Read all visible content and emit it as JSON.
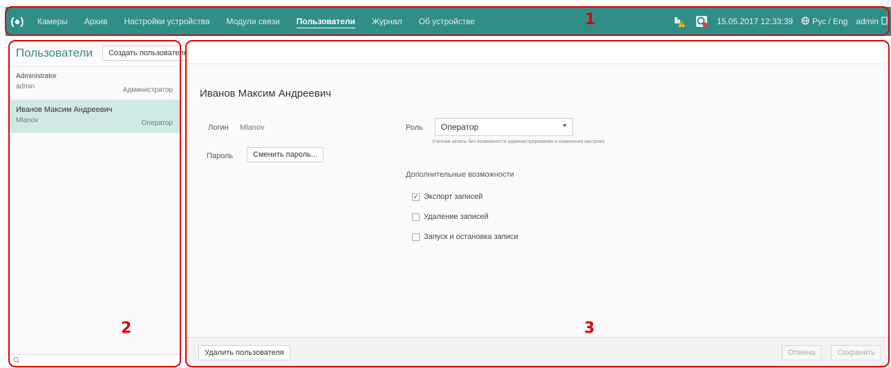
{
  "topbar": {
    "logo": "(●)",
    "nav": [
      {
        "label": "Камеры"
      },
      {
        "label": "Архив"
      },
      {
        "label": "Настройки устройства"
      },
      {
        "label": "Модули связи"
      },
      {
        "label": "Пользователи"
      },
      {
        "label": "Журнал"
      },
      {
        "label": "Об устройстве"
      }
    ],
    "active_nav": "Пользователи",
    "datetime": "15.05.2017  12:33:39",
    "lang": "Рус / Eng",
    "user": "admin",
    "icons": [
      "network-warning-icon",
      "recording-alert-icon",
      "globe-icon",
      "logout-icon"
    ],
    "accent": "#2f8f86"
  },
  "left": {
    "title": "Пользователи",
    "create_button": "Создать пользователя",
    "users": [
      {
        "name": "Administrator",
        "login": "admin",
        "role": "Администратор"
      },
      {
        "name": "Иванов Максим Андреевич",
        "login": "Mlanov",
        "role": "Оператор"
      }
    ],
    "selected_index": 1
  },
  "main": {
    "user_heading": "Иванов Максим Андреевич",
    "login_label": "Логин",
    "login_value": "Mlanov",
    "password_label": "Пароль",
    "change_password_button": "Сменить пароль...",
    "role_label": "Роль",
    "role_value": "Оператор",
    "role_description": "Учетная запись без возможности администрирования и изменения настроек",
    "extras_title": "Дополнительные возможности",
    "options": [
      {
        "label": "Экспорт записей",
        "checked": true
      },
      {
        "label": "Удаление записей",
        "checked": false
      },
      {
        "label": "Запуск и остановка записи",
        "checked": false
      }
    ],
    "delete_button": "Удалить пользователя",
    "cancel_button": "Отмена",
    "save_button": "Сохранить"
  },
  "annotations": [
    "1",
    "2",
    "3"
  ],
  "annotation_color": "#e00000"
}
